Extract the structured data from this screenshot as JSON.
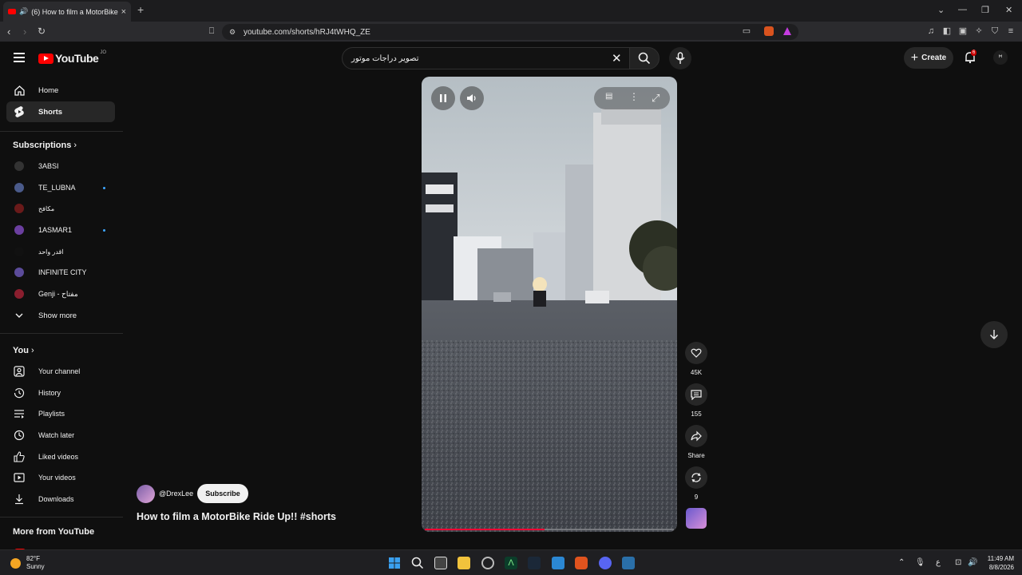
{
  "browser": {
    "tab_title": "(6) How to film a MotorBike R",
    "url": "youtube.com/shorts/hRJ4tWHQ_ZE"
  },
  "header": {
    "logo_text": "YouTube",
    "logo_country": "JO",
    "search_value": "تصوير دراجات موتور",
    "create_label": "Create",
    "notification_count": "6"
  },
  "sidebar": {
    "main": [
      {
        "label": "Home",
        "icon": "home-icon"
      },
      {
        "label": "Shorts",
        "icon": "shorts-icon",
        "active": true
      }
    ],
    "subscriptions_title": "Subscriptions",
    "subscriptions": [
      {
        "label": "3ABSI",
        "color": "#333333",
        "dot": false
      },
      {
        "label": "TE_LUBNA",
        "color": "#4a5a8a",
        "dot": true
      },
      {
        "label": "مكافح",
        "color": "#6a1a1a",
        "dot": false
      },
      {
        "label": "1ASMAR1",
        "color": "#6b3fa0",
        "dot": true
      },
      {
        "label": "اقدر واحد",
        "color": "#111111",
        "dot": false
      },
      {
        "label": "INFINITE CITY",
        "color": "#5b4b9a",
        "dot": false
      },
      {
        "label": "Genji - مفتاح",
        "color": "#8a1e2e",
        "dot": false
      }
    ],
    "show_more": "Show more",
    "you_title": "You",
    "you_items": [
      {
        "label": "Your channel",
        "icon": "channel-icon"
      },
      {
        "label": "History",
        "icon": "history-icon"
      },
      {
        "label": "Playlists",
        "icon": "playlists-icon"
      },
      {
        "label": "Watch later",
        "icon": "watch-later-icon"
      },
      {
        "label": "Liked videos",
        "icon": "thumb-up-icon"
      },
      {
        "label": "Your videos",
        "icon": "your-videos-icon"
      },
      {
        "label": "Downloads",
        "icon": "download-icon"
      }
    ],
    "more_title": "More from YouTube"
  },
  "short": {
    "channel": "@DrexLee",
    "subscribe_label": "Subscribe",
    "title": "How to film a MotorBike Ride Up!! #shorts",
    "progress": 0.48,
    "likes": "45K",
    "comments": "155",
    "share_label": "Share",
    "remix": "9"
  },
  "taskbar": {
    "temp": "82°F",
    "condition": "Sunny",
    "time": "11:49 AM",
    "date": "8/8/2026",
    "lang": "ع"
  }
}
